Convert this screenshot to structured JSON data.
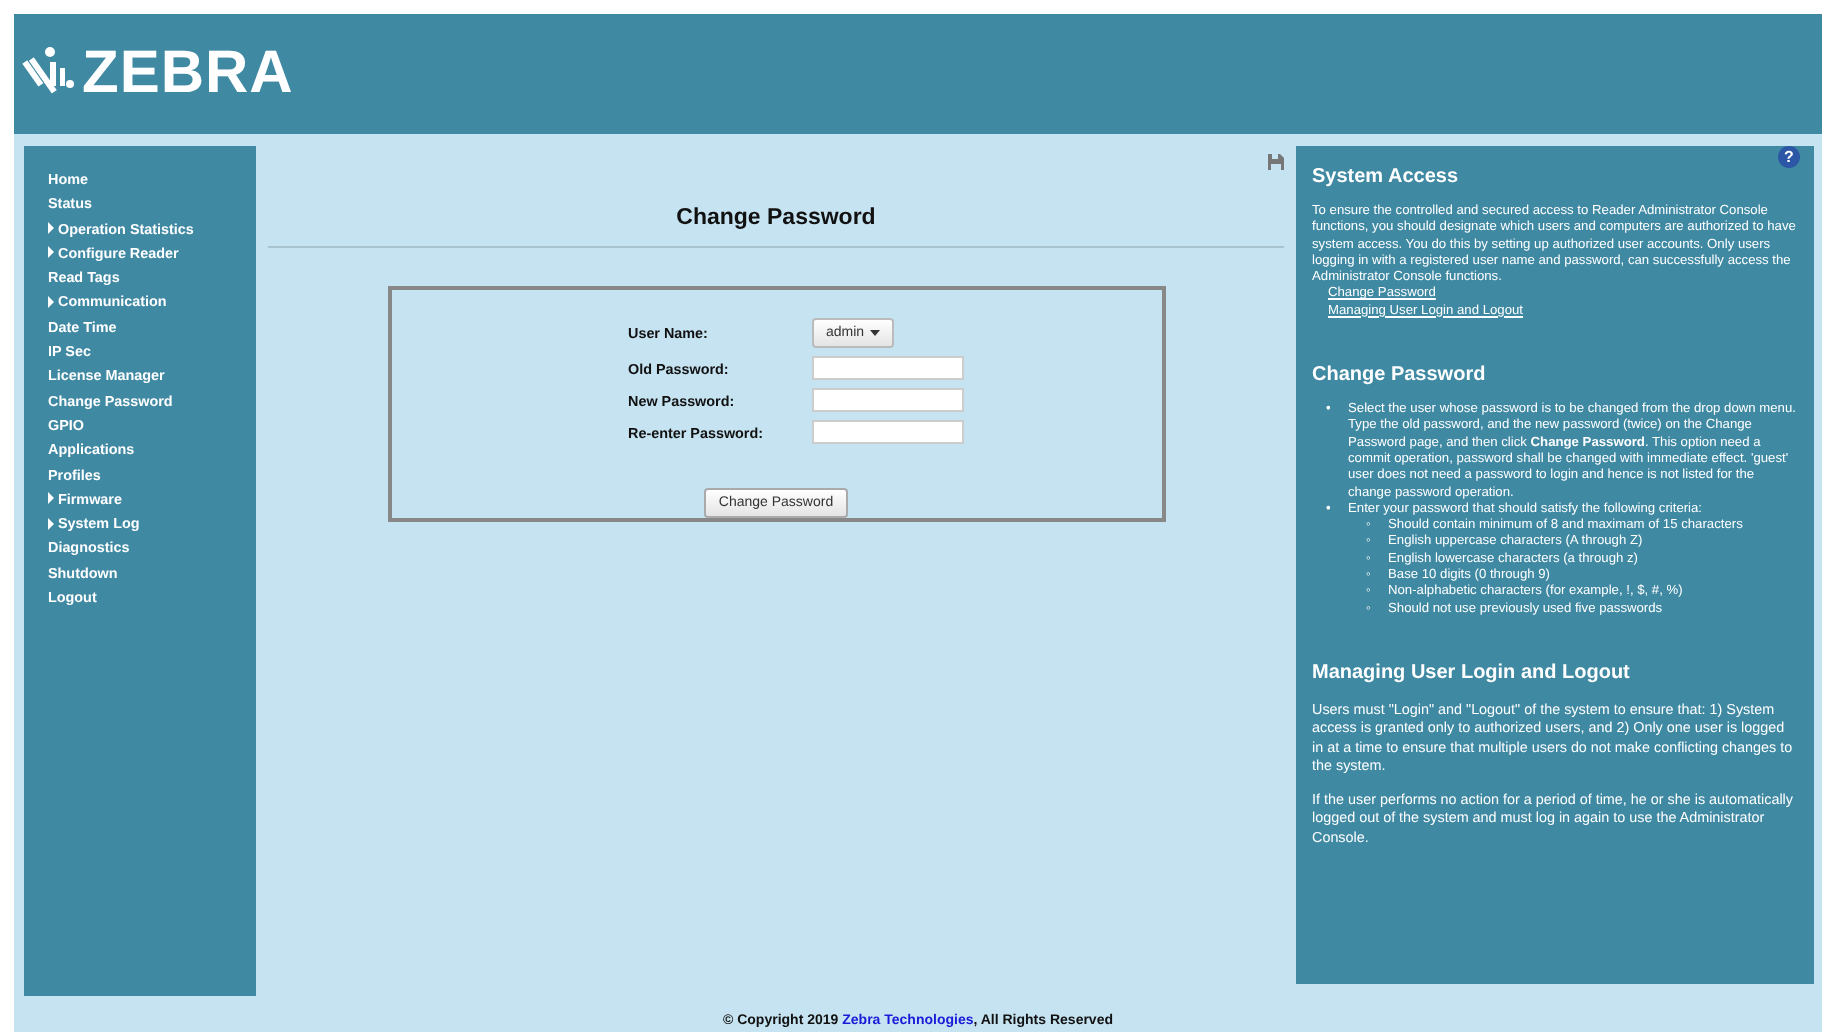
{
  "header": {
    "logo_text": "ZEBRA"
  },
  "sidebar": {
    "items": [
      {
        "label": "Home",
        "kind": "link"
      },
      {
        "label": "Status",
        "kind": "link"
      },
      {
        "label": "Operation Statistics",
        "kind": "group"
      },
      {
        "label": "Configure Reader",
        "kind": "group"
      },
      {
        "label": "Read Tags",
        "kind": "link"
      },
      {
        "label": "Communication",
        "kind": "group"
      },
      {
        "label": "Date Time",
        "kind": "link"
      },
      {
        "label": "IP Sec",
        "kind": "link"
      },
      {
        "label": "License Manager",
        "kind": "link"
      },
      {
        "label": "Change Password",
        "kind": "link"
      },
      {
        "label": "GPIO",
        "kind": "link"
      },
      {
        "label": "Applications",
        "kind": "link"
      },
      {
        "label": "Profiles",
        "kind": "link"
      },
      {
        "label": "Firmware",
        "kind": "group"
      },
      {
        "label": "System Log",
        "kind": "group"
      },
      {
        "label": "Diagnostics",
        "kind": "link"
      },
      {
        "label": "Shutdown",
        "kind": "link"
      },
      {
        "label": "Logout",
        "kind": "link"
      }
    ]
  },
  "main": {
    "title": "Change Password",
    "form": {
      "fields": [
        {
          "label": "User Name:",
          "kind": "dropdown",
          "value": "admin"
        },
        {
          "label": "Old Password:",
          "kind": "password"
        },
        {
          "label": "New Password:",
          "kind": "password"
        },
        {
          "label": "Re-enter Password:",
          "kind": "password"
        }
      ],
      "submit": "Change Password"
    }
  },
  "help": {
    "icon": "?",
    "sections": [
      {
        "title": "System Access",
        "paragraphs": [
          "To ensure the controlled and secured access to Reader Administrator Console functions, you should designate which users and computers are authorized to have system access. You do this by setting up authorized user accounts. Only users logging in with a registered user name and password, can successfully access the Administrator Console functions."
        ],
        "links": [
          "Change Password",
          "Managing User Login and Logout"
        ]
      },
      {
        "title": "Change Password",
        "bullets": [
          {
            "marker": "•",
            "text": "Select the user whose password is to be changed from the drop down menu. Type the old password, and the new password (twice) on the Change Password page, and then click **Change Password**. This option need a commit operation, password shall be changed with immediate effect. 'guest' user does not need a password to login and hence is not listed for the change password operation."
          },
          {
            "marker": "•",
            "text": "Enter your password that should satisfy the following criteria:",
            "child_marker": "◦",
            "children": [
              "Should contain minimum of 8 and maximam of 15 characters",
              "English uppercase characters (A through Z)",
              "English lowercase characters (a through z)",
              "Base 10 digits (0 through 9)",
              "Non-alphabetic characters (for example, !, $, #, %)",
              "Should not use previously used five passwords"
            ]
          }
        ]
      },
      {
        "title": "Managing User Login and Logout",
        "paragraphs": [
          "Users must \"Login\" and \"Logout\" of the system to ensure that: 1) System access is granted only to authorized users, and 2) Only one user is logged in at a time to ensure that multiple users do not make conflicting changes to the system.",
          "If the user performs no action for a period of time, he or she is automatically logged out of the system and must log in again to use the Administrator Console."
        ]
      }
    ]
  },
  "footer": {
    "prefix": "© Copyright 2019",
    "link": "Zebra Technologies",
    "suffix": ", All Rights Reserved"
  }
}
